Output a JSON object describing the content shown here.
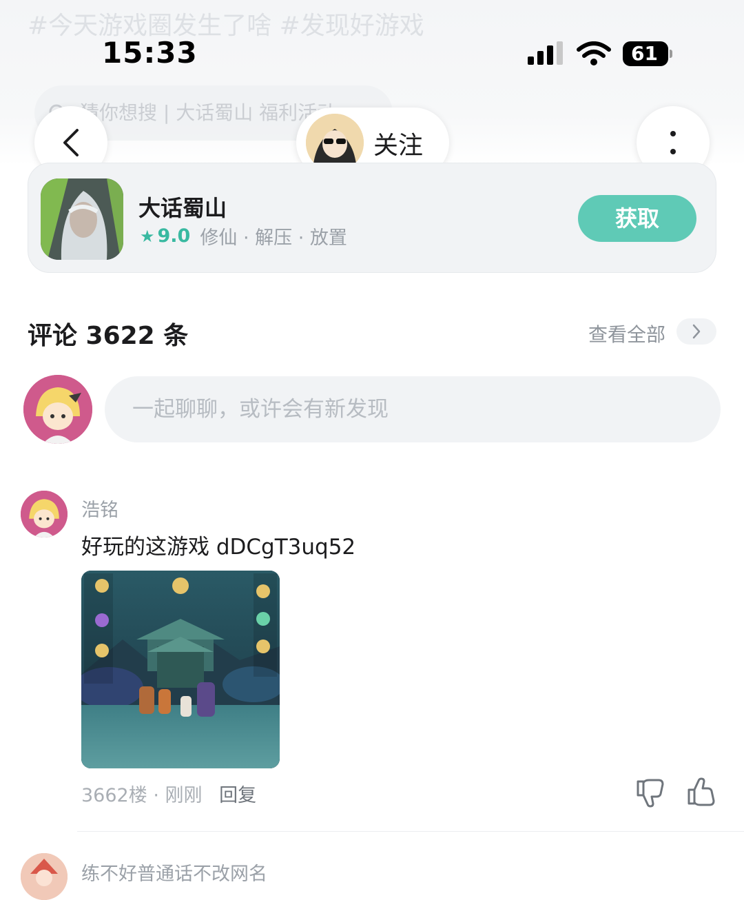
{
  "header": {
    "hashtags": "#今天游戏圈发生了啥 #发现好游戏",
    "search_placeholder": "猜你想搜 | 大话蜀山 福利活动",
    "follow_label": "关注"
  },
  "status_bar": {
    "time": "15:33",
    "battery": "61"
  },
  "game": {
    "title": "大话蜀山",
    "rating": "9.0",
    "tags": "修仙 · 解压 · 放置",
    "get_label": "获取",
    "accent_color": "#5fcab6"
  },
  "comments": {
    "title": "评论 3622 条",
    "view_all": "查看全部",
    "input_placeholder": "一起聊聊，或许会有新发现",
    "items": [
      {
        "username": "浩铭",
        "text": "好玩的这游戏 dDCgT3uq52",
        "floor": "3662楼",
        "time": "刚刚",
        "reply_label": "回复"
      },
      {
        "username": "练不好普通话不改网名"
      }
    ]
  },
  "icons": [
    "signal-icon",
    "wifi-icon",
    "battery-icon",
    "back-icon",
    "more-icon",
    "search-icon",
    "star-icon",
    "chevron-right-icon",
    "dislike-icon",
    "like-icon"
  ]
}
